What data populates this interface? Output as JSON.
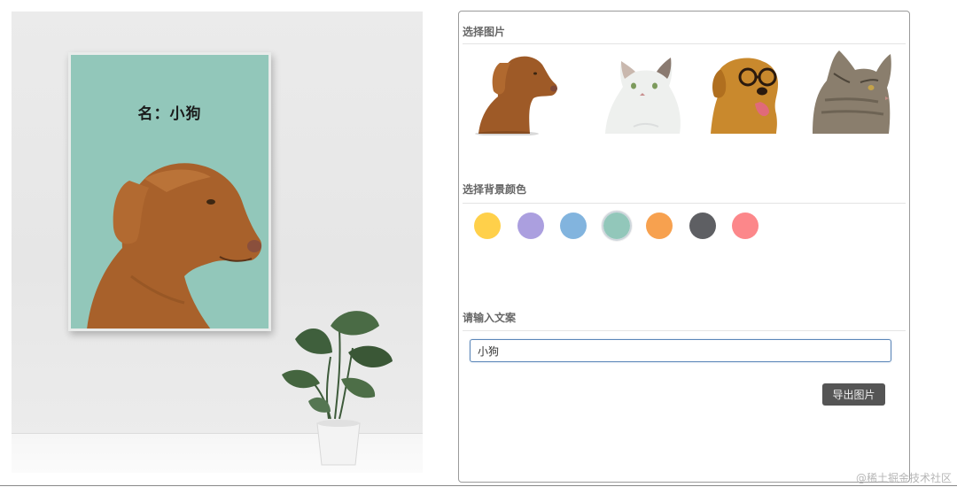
{
  "poster": {
    "caption": "名：小狗",
    "background_color": "#92c7ba",
    "pet_image": "dog-vizsla"
  },
  "panel": {
    "picture_section": {
      "title": "选择图片",
      "pets": [
        {
          "name": "dog-vizsla"
        },
        {
          "name": "cat-white"
        },
        {
          "name": "dog-golden-glasses"
        },
        {
          "name": "cat-tabby"
        }
      ]
    },
    "color_section": {
      "title": "选择背景颜色",
      "colors": [
        "#ffd04a",
        "#ab9fdf",
        "#82b4de",
        "#92c7ba",
        "#f7a14f",
        "#5e5f63",
        "#fc878a"
      ],
      "selected_index": 3
    },
    "text_section": {
      "title": "请输入文案",
      "input_value": "小狗"
    },
    "export_label": "导出图片"
  },
  "watermark": "@稀土掘金技术社区"
}
